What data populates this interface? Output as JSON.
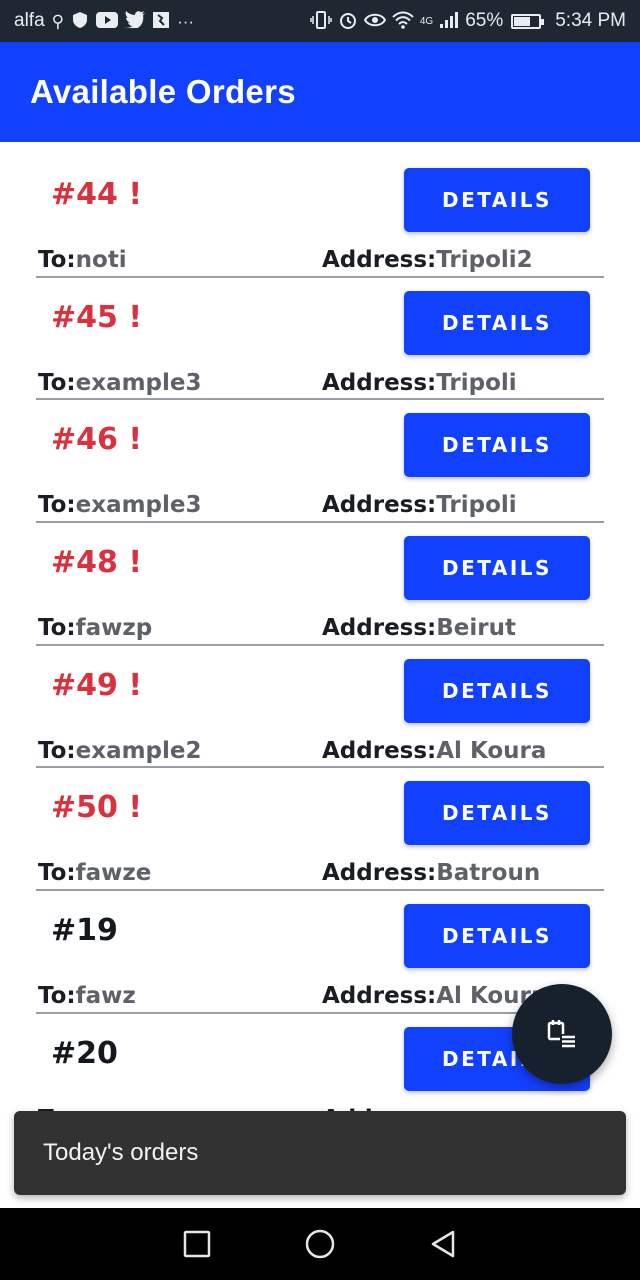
{
  "status_bar": {
    "carrier": "alfa",
    "icons_left": [
      "usb-icon",
      "shield-icon",
      "youtube-icon",
      "twitter-icon",
      "keep-icon",
      "more-icon"
    ],
    "icons_right": [
      "vibrate-icon",
      "alarm-icon",
      "eye-icon",
      "wifi-icon",
      "signal-icon"
    ],
    "network": "4G",
    "battery": "65%",
    "battery_level": 0.65,
    "time": "5:34 PM"
  },
  "app_bar": {
    "title": "Available Orders"
  },
  "labels": {
    "to": "To:",
    "address": "Address:"
  },
  "orders": [
    {
      "id": "#44 !",
      "urgent": true,
      "button": "DETAILS",
      "to": "noti",
      "address": "Tripoli2"
    },
    {
      "id": "#45 !",
      "urgent": true,
      "button": "DETAILS",
      "to": "example3",
      "address": "Tripoli"
    },
    {
      "id": "#46 !",
      "urgent": true,
      "button": "DETAILS",
      "to": "example3",
      "address": "Tripoli"
    },
    {
      "id": "#48 !",
      "urgent": true,
      "button": "DETAILS",
      "to": "fawzp",
      "address": "Beirut"
    },
    {
      "id": "#49 !",
      "urgent": true,
      "button": "DETAILS",
      "to": "example2",
      "address": "Al Koura"
    },
    {
      "id": "#50 !",
      "urgent": true,
      "button": "DETAILS",
      "to": "fawze",
      "address": "Batroun"
    },
    {
      "id": "#19",
      "urgent": false,
      "button": "DETAILS",
      "to": "fawz",
      "address": "Al Koura"
    },
    {
      "id": "#20",
      "urgent": false,
      "button": "DETAILS",
      "to": "",
      "address": ""
    }
  ],
  "fab": {
    "icon": "orders-calendar-icon"
  },
  "snackbar": {
    "text": "Today's orders"
  },
  "nav_bar": {
    "icons": [
      "recents-square-icon",
      "home-circle-icon",
      "back-triangle-icon"
    ]
  },
  "colors": {
    "primary": "#1240ff",
    "urgent": "#d9323e",
    "status_bar": "#1f2733",
    "fab": "#17212d",
    "snackbar": "#323232"
  }
}
